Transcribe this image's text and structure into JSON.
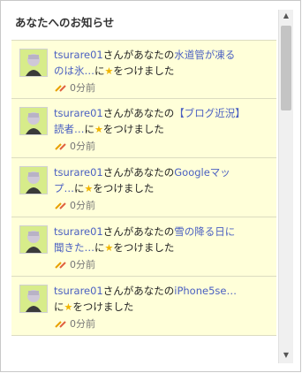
{
  "header": {
    "title": "あなたへのお知らせ"
  },
  "notifications": [
    {
      "user": "tsurare01",
      "pre": "さんがあなたの",
      "subject": "水道管が凍る",
      "line2": "のは氷…",
      "mid": "に",
      "suffix": "をつけました",
      "time": "0分前"
    },
    {
      "user": "tsurare01",
      "pre": "さんがあなたの",
      "subject": "【ブログ近況】",
      "line2": "読者…",
      "mid": "に",
      "suffix": "をつけました",
      "time": "0分前"
    },
    {
      "user": "tsurare01",
      "pre": "さんがあなたの",
      "subject": "Googleマッ",
      "line2": "プ…",
      "mid": "に",
      "suffix": "をつけました",
      "time": "0分前"
    },
    {
      "user": "tsurare01",
      "pre": "さんがあなたの",
      "subject": "雪の降る日に",
      "line2": "聞きた…",
      "mid": "に",
      "suffix": "をつけました",
      "time": "0分前"
    },
    {
      "user": "tsurare01",
      "pre": "さんがあなたの",
      "subject": "iPhone5se…",
      "line2": "",
      "mid": "に",
      "suffix": "をつけました",
      "time": "0分前"
    }
  ],
  "icons": {
    "star": "star-icon",
    "hatena": "hatena-bookmark-icon"
  },
  "colors": {
    "item_bg": "#ffffd9",
    "link": "#4a5fc1",
    "star": "#f0b400"
  }
}
